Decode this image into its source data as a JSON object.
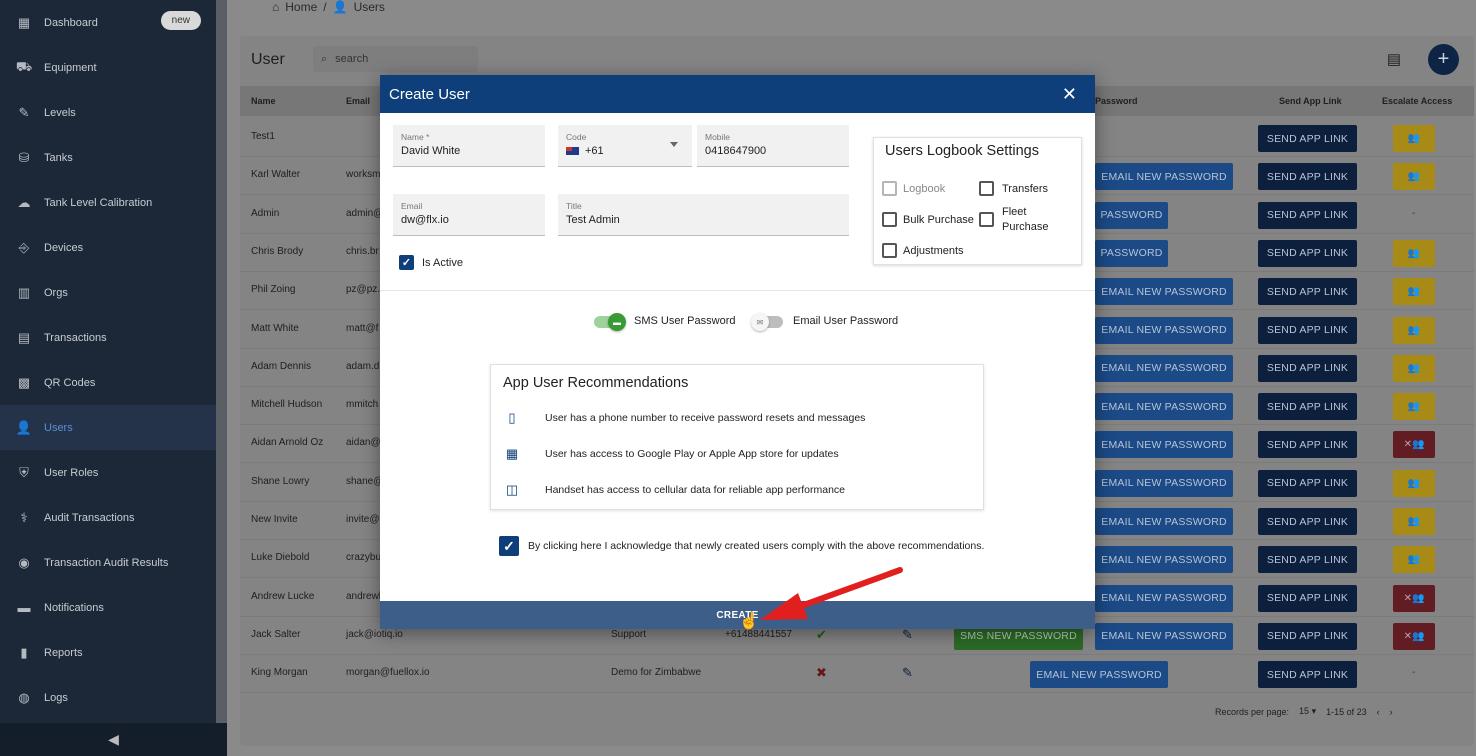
{
  "sidebar": {
    "items": [
      {
        "label": "Dashboard",
        "icon": "▦",
        "badge": "new"
      },
      {
        "label": "Equipment",
        "icon": "⛟"
      },
      {
        "label": "Levels",
        "icon": "✎"
      },
      {
        "label": "Tanks",
        "icon": "⛁"
      },
      {
        "label": "Tank Level Calibration",
        "icon": "☁"
      },
      {
        "label": "Devices",
        "icon": "⎆"
      },
      {
        "label": "Orgs",
        "icon": "▥"
      },
      {
        "label": "Transactions",
        "icon": "▤"
      },
      {
        "label": "QR Codes",
        "icon": "▩"
      },
      {
        "label": "Users",
        "icon": "👤"
      },
      {
        "label": "User Roles",
        "icon": "⛨"
      },
      {
        "label": "Audit Transactions",
        "icon": "⚕"
      },
      {
        "label": "Transaction Audit Results",
        "icon": "◉"
      },
      {
        "label": "Notifications",
        "icon": "▬"
      },
      {
        "label": "Reports",
        "icon": "▮"
      },
      {
        "label": "Logs",
        "icon": "◍"
      }
    ],
    "collapse_icon": "◀"
  },
  "breadcrumb": {
    "home": "Home",
    "sep": "/",
    "current": "Users"
  },
  "card": {
    "title": "User",
    "search_placeholder": "search"
  },
  "table": {
    "headers": {
      "name": "Name",
      "email": "Email",
      "password": "Password",
      "send_app_link": "Send App Link",
      "escalate": "Escalate Access"
    },
    "email_btn": "EMAIL NEW PASSWORD",
    "email_btn_cut": "PASSWORD",
    "link_btn": "SEND APP LINK",
    "sms_btn": "SMS NEW PASSWORD",
    "rows": [
      {
        "name": "Test1",
        "email": ""
      },
      {
        "name": "Karl Walter",
        "email": "worksm"
      },
      {
        "name": "Admin",
        "email": "admin@"
      },
      {
        "name": "Chris Brody",
        "email": "chris.br"
      },
      {
        "name": "Phil Zoing",
        "email": "pz@pz."
      },
      {
        "name": "Matt White",
        "email": "matt@f"
      },
      {
        "name": "Adam Dennis",
        "email": "adam.d"
      },
      {
        "name": "Mitchell Hudson",
        "email": "mmitch"
      },
      {
        "name": "Aidan Arnold Oz",
        "email": "aidan@"
      },
      {
        "name": "Shane Lowry",
        "email": "shane@"
      },
      {
        "name": "New Invite",
        "email": "invite@"
      },
      {
        "name": "Luke Diebold",
        "email": "crazybu"
      },
      {
        "name": "Andrew Lucke",
        "email": "andrewl"
      },
      {
        "name": "Jack Salter",
        "email": "jack@iotiq.io",
        "org": "Support",
        "mobile": "+61488441557"
      },
      {
        "name": "King Morgan",
        "email": "morgan@fuellox.io",
        "org": "Demo for Zimbabwe"
      }
    ],
    "escalate_none": "-"
  },
  "pager": {
    "label": "Records per page:",
    "per_page": "15",
    "range": "1-15 of 23"
  },
  "modal": {
    "title": "Create User",
    "name_label": "Name *",
    "name_value": "David White",
    "code_label": "Code",
    "code_value": "+61",
    "mobile_label": "Mobile",
    "mobile_value": "0418647900",
    "email_label": "Email",
    "email_value": "dw@flx.io",
    "title_label": "Title",
    "title_value": "Test Admin",
    "is_active": "Is Active",
    "logbook_title": "Users Logbook Settings",
    "logbook": "Logbook",
    "transfers": "Transfers",
    "bulk": "Bulk Purchase",
    "fleet1": "Fleet",
    "fleet2": "Purchase",
    "adjustments": "Adjustments",
    "sms_toggle": "SMS User Password",
    "email_toggle": "Email User Password",
    "rec_title": "App User Recommendations",
    "rec1": "User has a phone number to receive password resets and messages",
    "rec2": "User has access to Google Play or Apple App store for updates",
    "rec3": "Handset has access to cellular data for reliable app performance",
    "ack": "By clicking here I acknowledge that newly created users comply with the above recommendations.",
    "create": "CREATE"
  },
  "colors": {
    "modal_header": "#0e3f7a",
    "sidebar": "#1c2838",
    "arrow": "#e21f1f"
  }
}
